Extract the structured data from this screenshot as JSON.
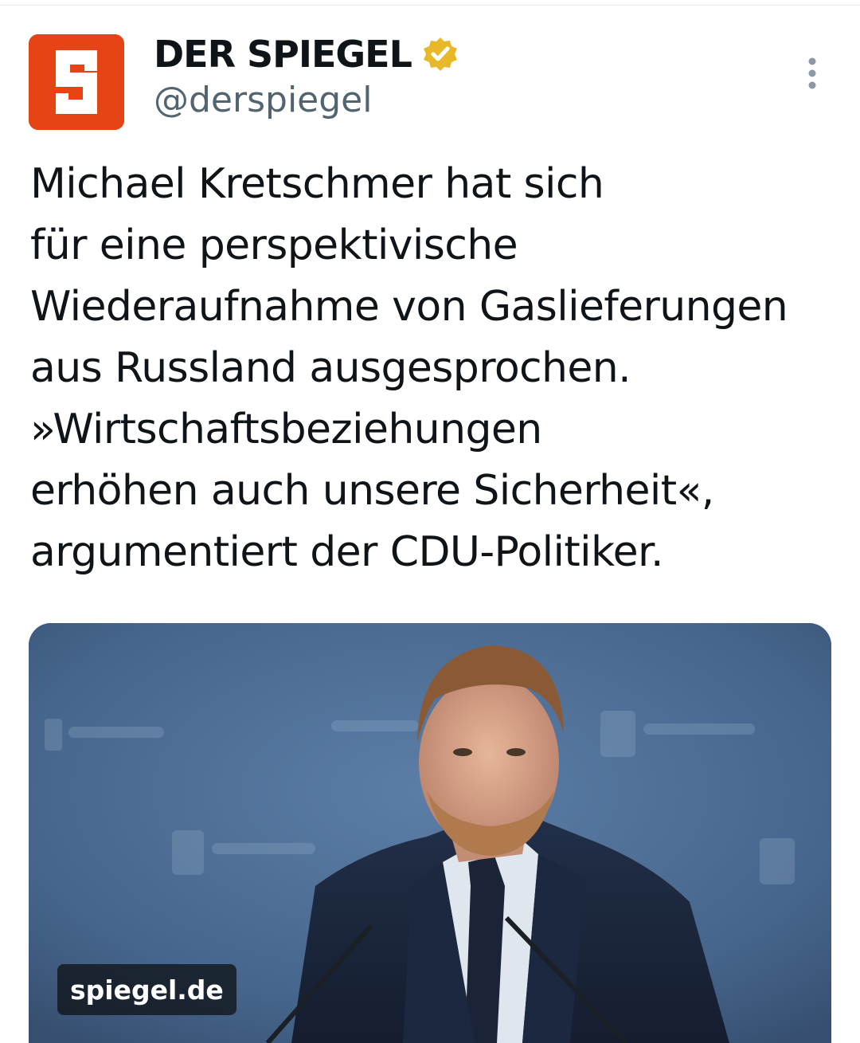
{
  "author": {
    "name": "DER SPIEGEL",
    "handle": "@derspiegel",
    "avatar_letter": "S",
    "brand_color": "#e64415",
    "verified_badge_color": "#e8b829",
    "verified_icon": "verified-badge-icon"
  },
  "actions": {
    "more_icon": "more-vertical-icon"
  },
  "tweet": {
    "lines": [
      "Michael Kretschmer hat sich",
      "für eine perspektivische",
      "Wiederaufnahme von Gaslieferungen",
      "aus Russland ausgesprochen.",
      "»Wirtschaftsbeziehungen",
      "erhöhen auch unsere Sicherheit«,",
      "argumentiert der CDU-Politiker."
    ]
  },
  "link_card": {
    "domain": "spiegel.de"
  }
}
